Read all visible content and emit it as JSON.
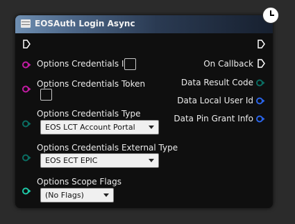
{
  "node": {
    "title": "EOSAuth Login Async",
    "inputs": {
      "credentials_id": {
        "label": "Options Credentials ID"
      },
      "credentials_token": {
        "label": "Options Credentials Token"
      },
      "credentials_type": {
        "label": "Options Credentials Type",
        "value": "EOS LCT Account Portal"
      },
      "external_type": {
        "label": "Options Credentials External Type",
        "value": "EOS ECT EPIC"
      },
      "scope_flags": {
        "label": "Options Scope Flags",
        "value": "(No Flags)"
      }
    },
    "outputs": {
      "on_callback": "On Callback",
      "result_code": "Data Result Code",
      "local_user_id": "Data Local User Id",
      "pin_grant_info": "Data Pin Grant Info"
    }
  },
  "colors": {
    "struct_pin": "#c21ba3",
    "enum_pin": "#0a6d62",
    "byte_pin": "#1ec7a6",
    "handle_pin": "#2a64e8"
  }
}
